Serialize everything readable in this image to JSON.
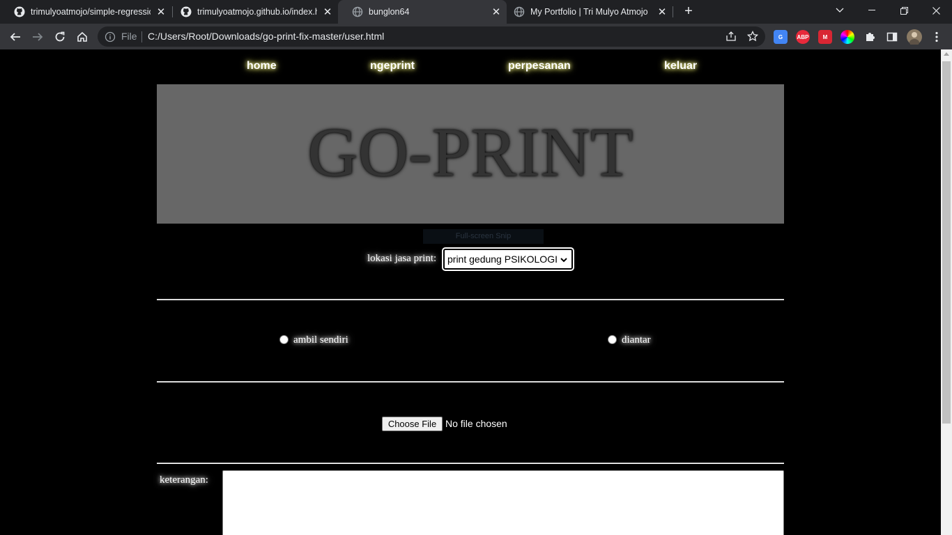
{
  "browser": {
    "tabs": [
      {
        "title": "trimulyoatmojo/simple-regressio",
        "favicon": "github-icon",
        "active": false
      },
      {
        "title": "trimulyoatmojo.github.io/index.h",
        "favicon": "github-icon",
        "active": false
      },
      {
        "title": "bunglon64",
        "favicon": "globe-icon",
        "active": true
      },
      {
        "title": "My Portfolio | Tri Mulyo Atmojo",
        "favicon": "globe-icon",
        "active": false
      }
    ],
    "address": {
      "scheme_label": "File",
      "url": "C:/Users/Root/Downloads/go-print-fix-master/user.html"
    },
    "extensions": [
      "translate-extension-icon",
      "adblock-plus-icon",
      "mendeley-icon",
      "color-picker-icon",
      "extensions-puzzle-icon"
    ]
  },
  "page": {
    "nav": {
      "home": "home",
      "ngeprint": "ngeprint",
      "perpesanan": "perpesanan",
      "keluar": "keluar"
    },
    "banner_title": "GO-PRINT",
    "tooltip": "Full-screen Snip",
    "location": {
      "label": "lokasi jasa print:",
      "selected": "print gedung PSIKOLOGI"
    },
    "delivery": {
      "option_pickup": "ambil sendiri",
      "option_delivered": "diantar"
    },
    "file_input": {
      "button": "Choose File",
      "status": "No file chosen"
    },
    "notes": {
      "label": "keterangan:"
    }
  }
}
